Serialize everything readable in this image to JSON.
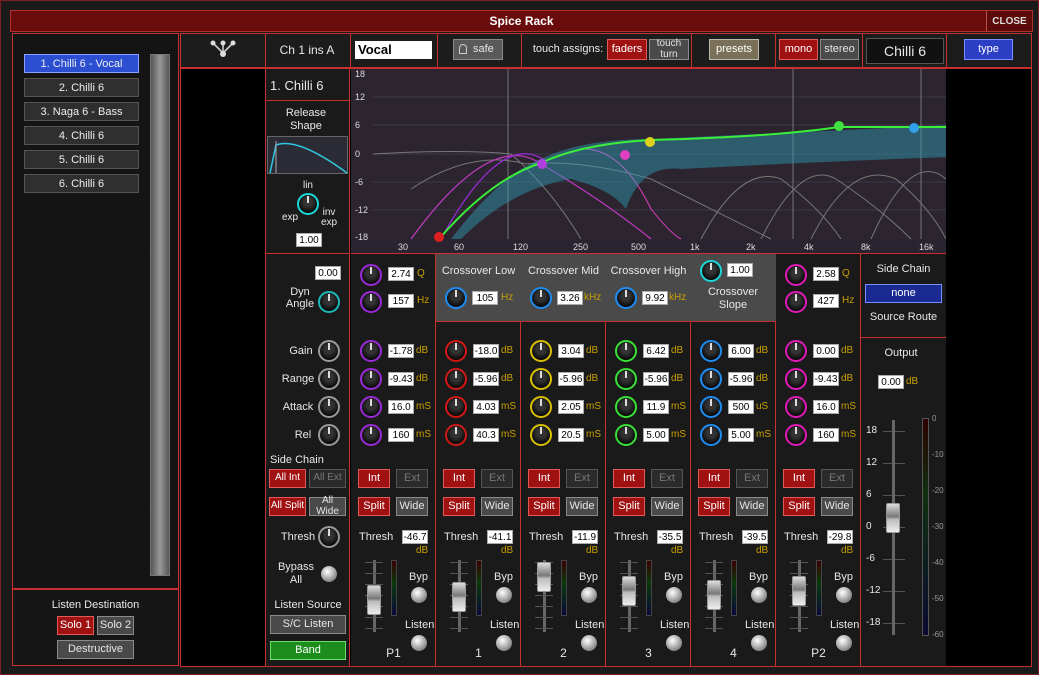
{
  "window": {
    "title": "Spice Rack",
    "close_label": "CLOSE"
  },
  "presets_list": {
    "items": [
      "1. Chilli 6 - Vocal",
      "2. Chilli 6",
      "3. Naga 6 - Bass",
      "4. Chilli 6",
      "5. Chilli 6",
      "6. Chilli 6"
    ],
    "selected": 0
  },
  "listen": {
    "title": "Listen Destination",
    "solo1": "Solo 1",
    "solo2": "Solo 2",
    "destructive": "Destructive"
  },
  "header": {
    "channel": "Ch 1 ins A",
    "name_value": "Vocal",
    "safe": "safe",
    "touch_assigns": "touch assigns:",
    "faders": "faders",
    "touch_turn": "touch turn",
    "presets": "presets",
    "mono": "mono",
    "stereo": "stereo",
    "model": "Chilli 6",
    "type": "type"
  },
  "left_col": {
    "preset_name": "1. Chilli 6",
    "release_shape": "Release Shape",
    "lin": "lin",
    "exp": "exp",
    "inv_exp": "inv exp",
    "release_value": "1.00",
    "dyn_angle_value": "0.00",
    "dyn_angle": "Dyn Angle",
    "gain": "Gain",
    "range": "Range",
    "attack": "Attack",
    "rel": "Rel",
    "side_chain": "Side Chain",
    "all_int": "All Int",
    "all_ext": "All Ext",
    "all_split": "All Split",
    "all_wide": "All Wide",
    "thresh": "Thresh",
    "bypass_all": "Bypass All",
    "listen_source": "Listen Source",
    "sc_listen": "S/C Listen",
    "band": "Band"
  },
  "graph": {
    "y_ticks": [
      "18",
      "12",
      "6",
      "0",
      "-6",
      "-12",
      "-18"
    ],
    "x_ticks": [
      "30",
      "60",
      "120",
      "250",
      "500",
      "1k",
      "2k",
      "4k",
      "8k",
      "16k"
    ]
  },
  "bands": [
    {
      "label": "P1",
      "color": "#9a2ad8",
      "q": "2.74",
      "q_unit": "Q",
      "freq": "157",
      "freq_unit": "Hz",
      "gain": "-1.78",
      "range": "-9.43",
      "attack": "16.0",
      "rel": "160",
      "thresh": "-46.7",
      "int": "Int",
      "ext": "Ext",
      "split": "Split",
      "wide": "Wide",
      "byp": "Byp",
      "listen": "Listen",
      "fader": 0.62
    },
    {
      "label": "1",
      "color": "#d01818",
      "header": "Crossover Low",
      "freq": "105",
      "freq_unit": "Hz",
      "gain": "-18.0",
      "range": "-5.96",
      "attack": "4.03",
      "rel": "40.3",
      "thresh": "-41.1",
      "int": "Int",
      "ext": "Ext",
      "split": "Split",
      "wide": "Wide",
      "byp": "Byp",
      "listen": "Listen",
      "fader": 0.55
    },
    {
      "label": "2",
      "color": "#d8c000",
      "header": "Crossover Mid",
      "freq": "3.26",
      "freq_unit": "kHz",
      "gain": "3.04",
      "range": "-5.96",
      "attack": "2.05",
      "rel": "20.5",
      "thresh": "-11.9",
      "int": "Int",
      "ext": "Ext",
      "split": "Split",
      "wide": "Wide",
      "byp": "Byp",
      "listen": "Listen",
      "fader": 0.1
    },
    {
      "label": "3",
      "color": "#38e038",
      "header": "Crossover High",
      "freq": "9.92",
      "freq_unit": "kHz",
      "gain": "6.42",
      "range": "-5.96",
      "attack": "11.9",
      "rel": "5.00",
      "thresh": "-35.5",
      "int": "Int",
      "ext": "Ext",
      "split": "Split",
      "wide": "Wide",
      "byp": "Byp",
      "listen": "Listen",
      "fader": 0.42
    },
    {
      "label": "4",
      "color": "#1e8cf0",
      "slope_value": "1.00",
      "slope_label": "Crossover Slope",
      "gain": "6.00",
      "range": "-5.96",
      "attack": "500",
      "attack_unit": "uS",
      "rel": "5.00",
      "thresh": "-39.5",
      "int": "Int",
      "ext": "Ext",
      "split": "Split",
      "wide": "Wide",
      "byp": "Byp",
      "listen": "Listen",
      "fader": 0.5
    },
    {
      "label": "P2",
      "color": "#e01ab8",
      "q": "2.58",
      "q_unit": "Q",
      "freq": "427",
      "freq_unit": "Hz",
      "gain": "0.00",
      "range": "-9.43",
      "attack": "16.0",
      "rel": "160",
      "thresh": "-29.8",
      "int": "Int",
      "ext": "Ext",
      "split": "Split",
      "wide": "Wide",
      "byp": "Byp",
      "listen": "Listen",
      "fader": 0.4
    }
  ],
  "units": {
    "db": "dB",
    "ms": "mS"
  },
  "output": {
    "side_chain": "Side Chain",
    "sc_value": "none",
    "source_route": "Source Route",
    "output": "Output",
    "output_value": "0.00",
    "unit": "dB",
    "scale": [
      "18",
      "12",
      "6",
      "0",
      "-6",
      "-12",
      "-18"
    ],
    "meter_scale": [
      "0",
      "-10",
      "-20",
      "-30",
      "-40",
      "-50",
      "-60"
    ],
    "fader": 0.5
  }
}
